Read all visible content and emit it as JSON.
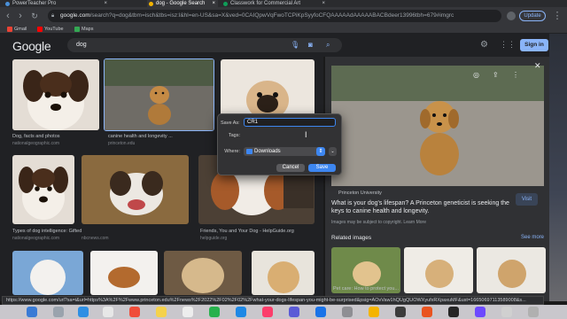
{
  "tabs": [
    {
      "label": "PowerTeacher Pro",
      "active": false
    },
    {
      "label": "dog - Google Search",
      "active": true
    },
    {
      "label": "Classwork for Commercial Art",
      "active": false
    }
  ],
  "toolbar": {
    "url_host": "google.com",
    "url_rest": "/search?q=dog&tbm=isch&tbs=isz:l&hl=en-US&sa=X&ved=0CAIQpwVqFwoTCPiKpSyyfoCFQAAAAAdAAAAABACBdeer13996tbh=679#imgrc",
    "update_label": "Update"
  },
  "bookmarks": [
    {
      "label": "Gmail",
      "icon": "gmail-icon"
    },
    {
      "label": "YouTube",
      "icon": "youtube-icon"
    },
    {
      "label": "Maps",
      "icon": "maps-icon"
    }
  ],
  "google": {
    "logo": "Google",
    "query": "dog",
    "signin_label": "Sign in"
  },
  "results": [
    {
      "title": "Dog, facts and photos",
      "source": "nationalgeographic.com"
    },
    {
      "title": "canine health and longevity ...",
      "source": "princeton.edu"
    },
    {
      "title": "",
      "source": ""
    },
    {
      "title": "Types of dog intelligence: Gifted dogs ...",
      "source": "nationalgeographic.com"
    },
    {
      "title": "",
      "source": "nbcnews.com"
    },
    {
      "title": "Friends, You and Your Dog - HelpGuide.org",
      "source": "helpguide.org"
    }
  ],
  "panel": {
    "source": "Princeton University",
    "title": "What is your dog's lifespan? A Princeton geneticist is seeking the keys to canine health and longevity.",
    "note": "Images may be subject to copyright. Learn More",
    "visit_label": "Visit",
    "related_label": "Related images",
    "see_more_label": "See more",
    "related_caption": "Pet care: How to protect you..."
  },
  "dialog": {
    "save_as_label": "Save As:",
    "save_as_value": "CR1",
    "tags_label": "Tags:",
    "tags_value": "",
    "where_label": "Where:",
    "where_value": "Downloads",
    "cancel_label": "Cancel",
    "save_label": "Save"
  },
  "status_url": "https://www.google.com/url?sa=i&url=https%3A%2F%2Fwww.princeton.edu%2Fnews%2F2022%2F02%2F02%2Fwhat-your-dogs-lifespan-you-might-be-surprised&psig=AOvVaw1hQUgQUOWXyufxRXpaxuMF&ust=16650697113589008&s..."
}
